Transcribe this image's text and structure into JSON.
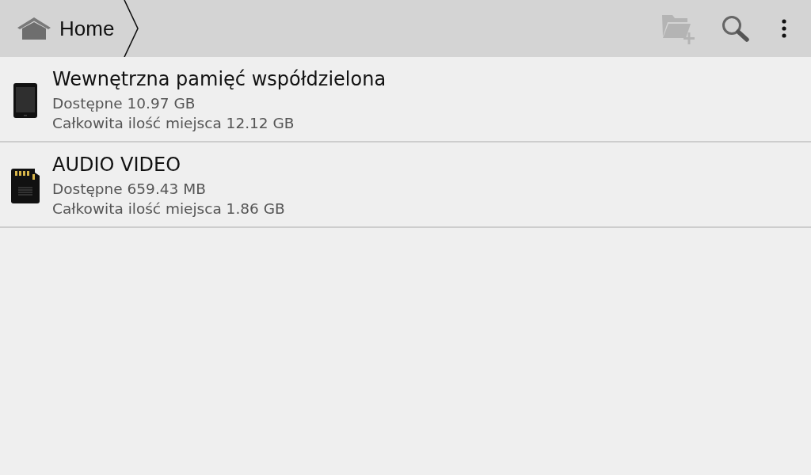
{
  "breadcrumb": {
    "label": "Home"
  },
  "toolbar": [
    {
      "kind": "new-folder",
      "disabled": true
    },
    {
      "kind": "search",
      "disabled": false
    },
    {
      "kind": "overflow",
      "disabled": false
    }
  ],
  "storage": [
    {
      "kind": "phone",
      "name": "Wewnętrzna pamięć współdzielona",
      "available": "Dostępne 10.97 GB",
      "total": "Całkowita ilość miejsca 12.12 GB"
    },
    {
      "kind": "sd-card",
      "name": "AUDIO VIDEO",
      "available": "Dostępne 659.43 MB",
      "total": "Całkowita ilość miejsca 1.86 GB"
    }
  ]
}
